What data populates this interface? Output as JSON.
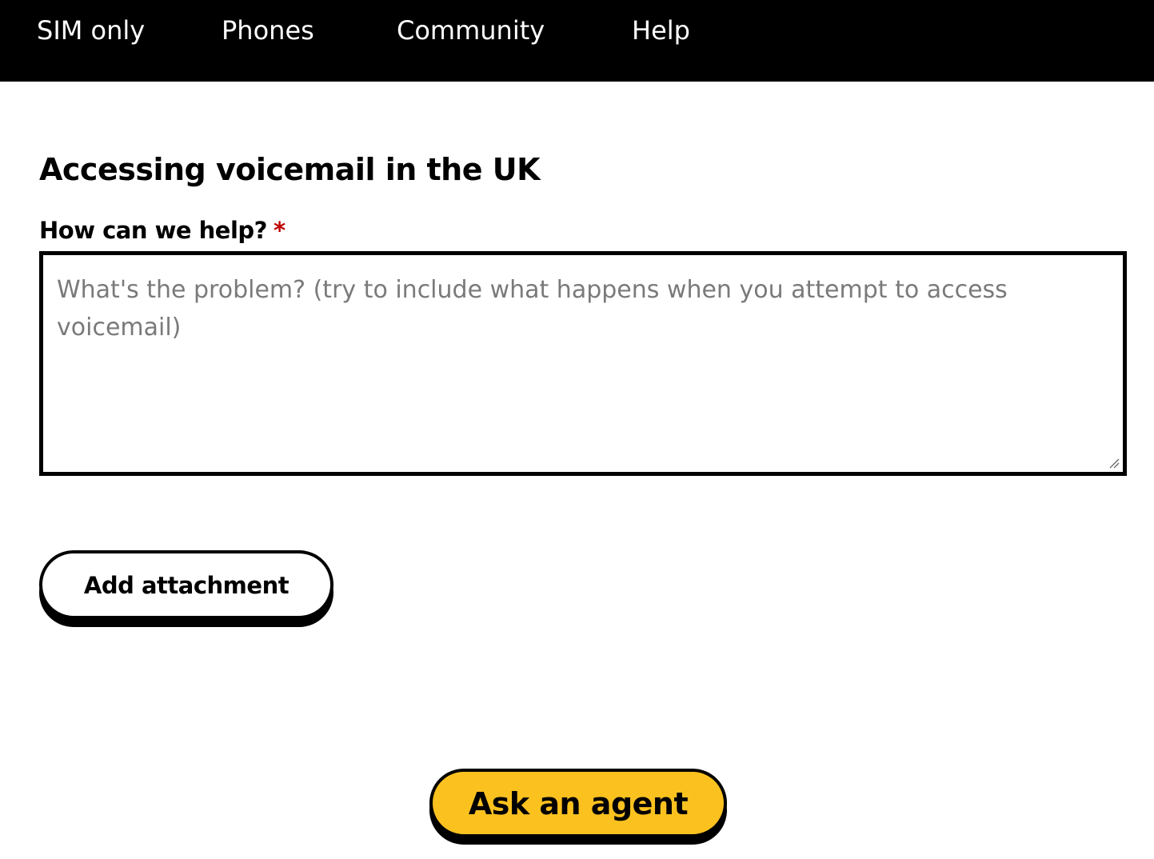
{
  "nav": {
    "items": [
      {
        "label": "SIM only"
      },
      {
        "label": "Phones"
      },
      {
        "label": "Community"
      },
      {
        "label": "Help"
      }
    ]
  },
  "form": {
    "title": "Accessing voicemail in the UK",
    "label": "How can we help?",
    "required_marker": "*",
    "textarea_value": "",
    "textarea_placeholder": "What's the problem? (try to include what happens when you attempt to access voicemail)",
    "attach_label": "Add attachment",
    "submit_label": "Ask an agent"
  },
  "colors": {
    "nav_background": "#000000",
    "submit_background": "#fbc11f",
    "required_marker": "#c00000"
  }
}
